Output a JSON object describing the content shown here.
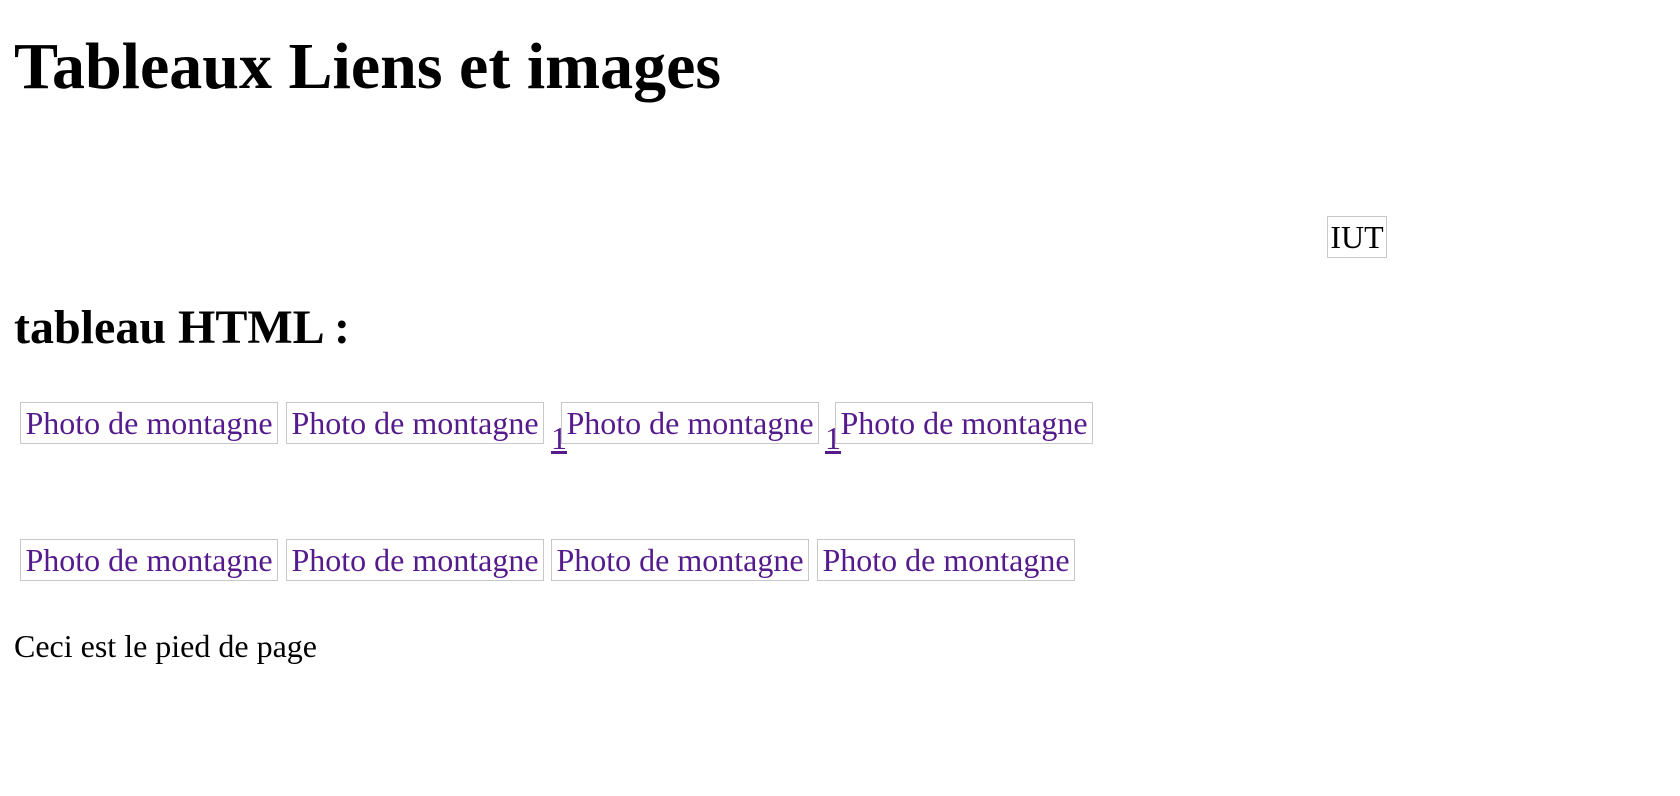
{
  "page": {
    "title": "Tableaux Liens et images",
    "logo_alt": "IUT",
    "section_title": "tableau HTML :",
    "footer": "Ceci est le pied de page"
  },
  "gallery": {
    "row1": [
      {
        "label": "Photo de montagne"
      },
      {
        "label": "Photo de montagne"
      },
      {
        "label": "Photo de montagne"
      },
      {
        "label": "Photo de montagne"
      }
    ],
    "row1_stray_links": [
      "1",
      "1"
    ],
    "row2": [
      {
        "label": "Photo de montagne"
      },
      {
        "label": "Photo de montagne"
      },
      {
        "label": "Photo de montagne"
      },
      {
        "label": "Photo de montagne"
      }
    ]
  },
  "colors": {
    "link_visited": "#551a8b",
    "border": "#c8c8c8",
    "text": "#000000"
  }
}
